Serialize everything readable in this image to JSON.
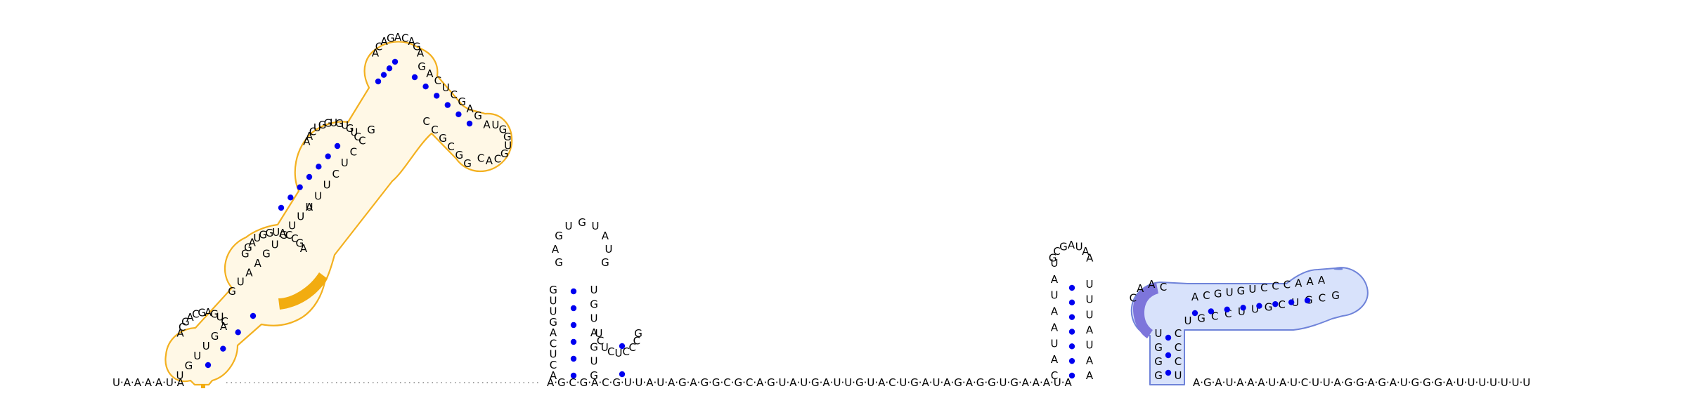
{
  "backbone": {
    "left": "U·A·A·A·A·U·A",
    "middle": "A·G·C·G·A·C·G·U·U·A·U·A·G·A·G·G·C·G·C·A·G·U·A·U·G·A·U·U·G·U·A·C·U·G·A·U·A·G·A·G·G·U·G·A·A·A·U·A",
    "right": "A·G·A·U·A·A·A·U·A·U·C·U·U·A·G·G·A·G·A·U·G·G·G·A·U·U·U·U·U·U·U"
  },
  "colors": {
    "pair_dot": "#0000f0",
    "orange_outline": "#f3b01f",
    "orange_fill": "#fff8e6",
    "orange_marker": "#f2ac10",
    "blue_fill": "#d8e2fb",
    "blue_outline": "#6f83d9",
    "purple_marker": "#7d75db"
  },
  "hairpin_a": {
    "left_stem": [
      "A",
      "C",
      "U",
      "C",
      "A",
      "G",
      "U",
      "U",
      "G"
    ],
    "loop": [
      "G",
      "A",
      "G",
      "U",
      "G",
      "U",
      "A",
      "U",
      "G"
    ],
    "right_stem": [
      "G",
      "U",
      "G",
      "A",
      "U",
      "G",
      "U"
    ],
    "small_loop": [
      "U",
      "C",
      "U",
      "C",
      "U",
      "C",
      "C",
      "C",
      "G"
    ]
  },
  "hairpin_b": {
    "left_stem": [
      "C",
      "A",
      "U",
      "A",
      "A",
      "U",
      "A",
      "U"
    ],
    "loop": [
      "G",
      "C",
      "G",
      "A",
      "U",
      "A",
      "A"
    ],
    "right_stem": [
      "A",
      "A",
      "U",
      "A",
      "U",
      "U",
      "U"
    ]
  },
  "highlight_a": {
    "letters": [
      "U",
      "G",
      "U",
      "U",
      "G",
      "A",
      "A",
      "C",
      "G",
      "A",
      "C",
      "G",
      "A",
      "G",
      "U",
      "C",
      "G",
      "U",
      "A",
      "A",
      "G",
      "U",
      "G",
      "U",
      "U",
      "U",
      "G",
      "G",
      "A",
      "U",
      "G",
      "G",
      "U",
      "A",
      "C",
      "C",
      "G",
      "A",
      "A",
      "U",
      "U",
      "C",
      "U",
      "C",
      "C",
      "G",
      "A",
      "A",
      "C",
      "U",
      "G",
      "G",
      "U",
      "G",
      "U",
      "G",
      "U",
      "C",
      "A",
      "C",
      "A",
      "G",
      "A",
      "C",
      "A",
      "G",
      "A",
      "G",
      "A",
      "C",
      "U",
      "C",
      "G",
      "A",
      "G",
      "A",
      "U",
      "G",
      "G",
      "U",
      "G",
      "C",
      "A",
      "C",
      "G",
      "G",
      "C",
      "G",
      "C",
      "C"
    ]
  },
  "highlight_b": {
    "left_stem": [
      "G",
      "G",
      "G",
      "U"
    ],
    "right_stem": [
      "U",
      "C",
      "C",
      "C"
    ],
    "top_row": [
      "C",
      "A",
      "A",
      "C",
      "A",
      "C",
      "G",
      "U",
      "G",
      "U",
      "C",
      "C",
      "C",
      "A",
      "A",
      "A"
    ],
    "bottom_row": [
      "U",
      "G",
      "C",
      "C",
      "U",
      "U",
      "G",
      "C",
      "U",
      "G",
      "C",
      "G"
    ]
  }
}
